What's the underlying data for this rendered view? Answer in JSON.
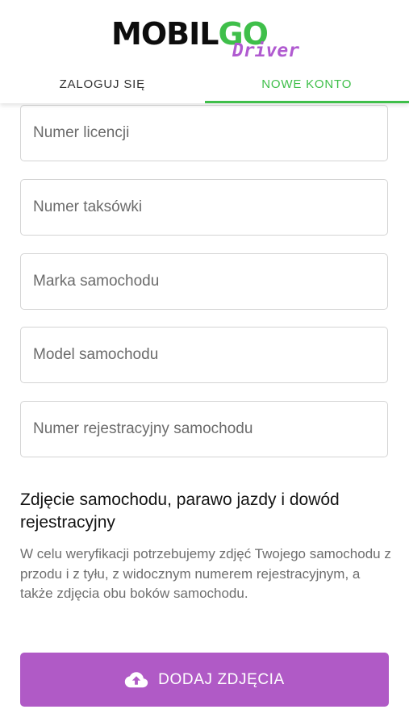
{
  "logo": {
    "main_part1": "MOBIL",
    "main_part2": "GO",
    "sub": "Driver"
  },
  "tabs": [
    {
      "label": "ZALOGUJ SIĘ",
      "active": false
    },
    {
      "label": "NOWE KONTO",
      "active": true
    }
  ],
  "form": {
    "fields": [
      {
        "placeholder": "Numer licencji",
        "value": ""
      },
      {
        "placeholder": "Numer taksówki",
        "value": ""
      },
      {
        "placeholder": "Marka samochodu",
        "value": ""
      },
      {
        "placeholder": "Model samochodu",
        "value": ""
      },
      {
        "placeholder": "Numer rejestracyjny samochodu",
        "value": ""
      }
    ]
  },
  "photos": {
    "title": "Zdjęcie samochodu, parawo jazdy i dowód rejestracyjny",
    "description": "W celu weryfikacji potrzebujemy zdjęć Twojego samochodu z przodu i z tyłu, z widocznym numerem rejestracyjnym, a także zdjęcia obu boków samochodu.",
    "button_label": "DODAJ ZDJĘCIA",
    "button_icon": "cloud-upload-icon"
  },
  "colors": {
    "brand_green": "#3fbf4a",
    "brand_purple": "#b05ac6",
    "logo_purple": "#b05ad0"
  }
}
